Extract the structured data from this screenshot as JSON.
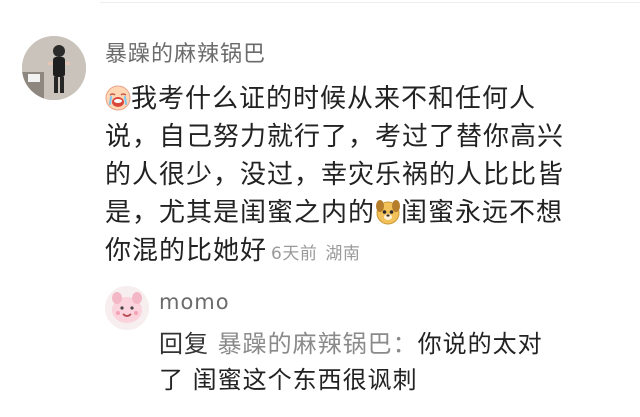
{
  "comment": {
    "username": "暴躁的麻辣锅巴",
    "avatar_icon": "user-photo-avatar",
    "lead_emoji": "crying-face-emoji",
    "inline_emoji": "dog-face-emoji",
    "lines": [
      "我考什么证的时候从来不和任何人",
      "说，自己努力就行了，考过了替你高兴",
      "的人很少，没过，幸灾乐祸的人比比皆",
      "是，尤其是闺蜜之内的",
      "闺蜜永远不想",
      "你混的比她好"
    ],
    "time": "6天前",
    "location": "湖南"
  },
  "reply": {
    "username": "momo",
    "avatar_icon": "cartoon-avatar",
    "prefix": "回复",
    "target_name": "暴躁的麻辣锅巴：",
    "text_line1": "你说的太对",
    "text_line2": "了 闺蜜这个东西很讽刺"
  }
}
